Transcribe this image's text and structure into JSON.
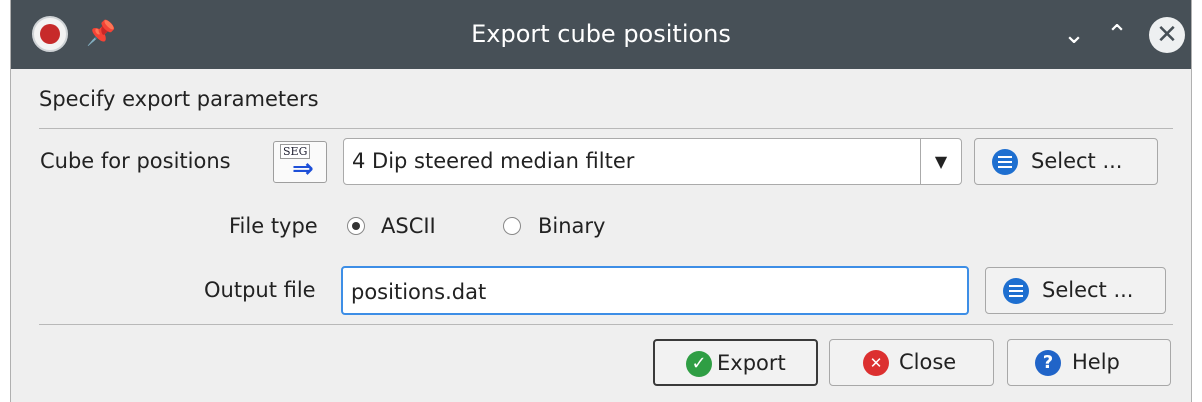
{
  "window": {
    "title": "Export cube positions",
    "controls": {
      "minimize_icon": "chevron-down-icon",
      "maximize_icon": "chevron-up-icon",
      "close_icon": "close-icon"
    }
  },
  "heading": "Specify export parameters",
  "cube": {
    "label": "Cube for positions",
    "selected": "4 Dip steered median filter",
    "select_button": "Select ..."
  },
  "file_type": {
    "label": "File type",
    "options": [
      {
        "label": "ASCII",
        "checked": true
      },
      {
        "label": "Binary",
        "checked": false
      }
    ]
  },
  "output": {
    "label": "Output file",
    "value": "positions.dat",
    "select_button": "Select ..."
  },
  "buttons": {
    "export": "Export",
    "close": "Close",
    "help": "Help"
  },
  "colors": {
    "titlebar": "#475057",
    "focus": "#3d8ee6"
  }
}
